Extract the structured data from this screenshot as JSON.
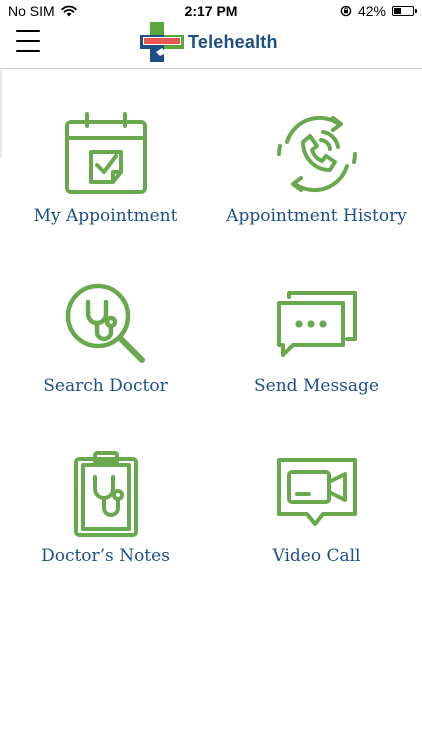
{
  "status_bar": {
    "carrier": "No SIM",
    "time": "2:17 PM",
    "battery_percent": "42%",
    "battery_level": 0.42,
    "icons": [
      "wifi-icon",
      "orientation-lock-icon",
      "battery-icon"
    ]
  },
  "header": {
    "brand_name": "Telehealth",
    "menu_icon": "hamburger-menu-icon",
    "logo_icon": "medical-cross-logo-icon"
  },
  "colors": {
    "icon_green": "#6aa84f",
    "label_blue": "#1d4f86",
    "logo_green": "#5aa83c",
    "logo_blue": "#1d4f86"
  },
  "tiles": [
    {
      "label": "My Appointment",
      "icon": "calendar-check-icon"
    },
    {
      "label": "Appointment History",
      "icon": "phone-history-icon"
    },
    {
      "label": "Search Doctor",
      "icon": "search-stethoscope-icon"
    },
    {
      "label": "Send Message",
      "icon": "chat-bubbles-icon"
    },
    {
      "label": "Doctor’s Notes",
      "icon": "clipboard-stethoscope-icon"
    },
    {
      "label": "Video Call",
      "icon": "video-camera-icon"
    }
  ]
}
